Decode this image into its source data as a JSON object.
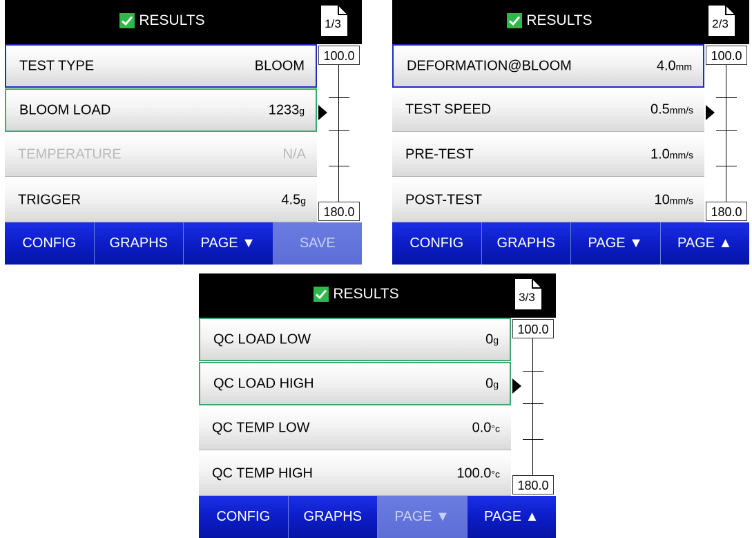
{
  "screens": [
    {
      "title": "RESULTS",
      "page": "1/3",
      "scale_top": "100.0",
      "scale_bottom": "180.0",
      "rows": [
        {
          "label": "TEST TYPE",
          "value": "BLOOM",
          "unit": ""
        },
        {
          "label": "BLOOM LOAD",
          "value": "1233",
          "unit": "g"
        },
        {
          "label": "TEMPERATURE",
          "value": "N/A",
          "unit": ""
        },
        {
          "label": "TRIGGER",
          "value": "4.5",
          "unit": "g"
        }
      ],
      "buttons": [
        "CONFIG",
        "GRAPHS",
        "PAGE ▼",
        "SAVE"
      ]
    },
    {
      "title": "RESULTS",
      "page": "2/3",
      "scale_top": "100.0",
      "scale_bottom": "180.0",
      "rows": [
        {
          "label": "DEFORMATION@BLOOM",
          "value": "4.0",
          "unit": "mm"
        },
        {
          "label": "TEST SPEED",
          "value": "0.5",
          "unit": "mm/s"
        },
        {
          "label": "PRE-TEST",
          "value": "1.0",
          "unit": "mm/s"
        },
        {
          "label": "POST-TEST",
          "value": "10",
          "unit": "mm/s"
        }
      ],
      "buttons": [
        "CONFIG",
        "GRAPHS",
        "PAGE ▼",
        "PAGE ▲"
      ]
    },
    {
      "title": "RESULTS",
      "page": "3/3",
      "scale_top": "100.0",
      "scale_bottom": "180.0",
      "rows": [
        {
          "label": "QC LOAD LOW",
          "value": "0",
          "unit": "g"
        },
        {
          "label": "QC LOAD HIGH",
          "value": "0",
          "unit": "g"
        },
        {
          "label": "QC TEMP LOW",
          "value": "0.0",
          "unit": "°c"
        },
        {
          "label": "QC TEMP HIGH",
          "value": "100.0",
          "unit": "°c"
        }
      ],
      "buttons": [
        "CONFIG",
        "GRAPHS",
        "PAGE ▼",
        "PAGE ▲"
      ]
    }
  ],
  "icons": {
    "header_check": "checkmark-icon",
    "page_counter": "page-icon",
    "scale_pointer": "pointer-arrow-icon"
  },
  "colors": {
    "header_bg": "#000000",
    "check_green": "#2eb84a",
    "button_blue": "#0b1cc4",
    "selected_blue": "#1f2bc2",
    "selected_green": "#3aaa6a",
    "disabled_text": "#b9b9b9"
  }
}
